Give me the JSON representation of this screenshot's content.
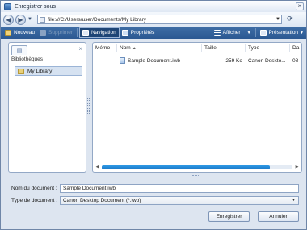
{
  "window": {
    "title": "Enregistrer sous",
    "close_glyph": "×"
  },
  "addressbar": {
    "back_icon": "back-arrow-icon",
    "forward_icon": "forward-arrow-icon",
    "path": "file:///C:/Users/user/Documents/My Library"
  },
  "toolbar": {
    "new_label": "Nouveau",
    "delete_label": "Supprimer",
    "navigation_label": "Navigation",
    "properties_label": "Propriétés",
    "view_label": "Afficher",
    "presentation_label": "Présentation"
  },
  "sidebar": {
    "title": "Bibliothèques",
    "items": [
      {
        "label": "My Library"
      }
    ]
  },
  "filelist": {
    "columns": [
      "Mémo",
      "Nom",
      "Taille",
      "Type",
      "Da"
    ],
    "sorted_column": "Nom",
    "rows": [
      {
        "memo": "",
        "name": "Sample Document.iwb",
        "size": "259 Ko",
        "type": "Canon Deskto...",
        "date": "08"
      }
    ]
  },
  "form": {
    "name_label": "Nom du document :",
    "name_value": "Sample Document.iwb",
    "type_label": "Type de document :",
    "type_value": "Canon Desktop Document (*.iwb)"
  },
  "buttons": {
    "save": "Enregistrer",
    "cancel": "Annuler"
  },
  "colors": {
    "toolbar": "#2b5892",
    "accent": "#1a74c4",
    "window": "#dde5f0"
  }
}
